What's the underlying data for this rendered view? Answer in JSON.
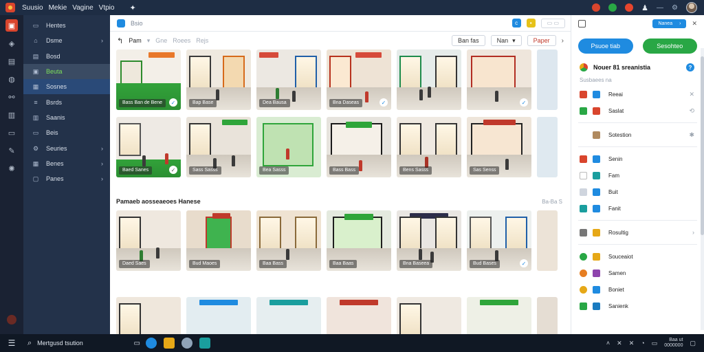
{
  "app": {
    "menu": [
      "Suusio",
      "Mekie",
      "Vagine",
      "Vtpio"
    ],
    "title": "Bsio"
  },
  "sidebar": {
    "items": [
      {
        "label": "Hentes",
        "icon": "folder-icon",
        "chevron": false
      },
      {
        "label": "Dsme",
        "icon": "home-icon",
        "chevron": true
      },
      {
        "label": "Bosd",
        "icon": "doc-icon",
        "chevron": false
      },
      {
        "label": "Beuta",
        "icon": "image-icon",
        "chevron": false,
        "selected": "green"
      },
      {
        "label": "Sosnes",
        "icon": "list-icon",
        "chevron": false,
        "selected": "blue"
      },
      {
        "label": "Bsrds",
        "icon": "stack-icon",
        "chevron": false
      },
      {
        "label": "Saanis",
        "icon": "grid-icon",
        "chevron": false
      },
      {
        "label": "Beis",
        "icon": "tag-icon",
        "chevron": false
      },
      {
        "label": "Seuries",
        "icon": "settings-icon",
        "chevron": true
      },
      {
        "label": "Benes",
        "icon": "calendar-icon",
        "chevron": true
      },
      {
        "label": "Panes",
        "icon": "star-icon",
        "chevron": true
      }
    ]
  },
  "filterbar": {
    "primary": "Pam",
    "secondary": [
      "Gne",
      "Roees",
      "Rejs"
    ],
    "button1": "Ban fas",
    "select": "Nan",
    "button2": "Paper"
  },
  "tiles_row1": [
    "Bass Ban de Bene",
    "Bap Base",
    "Dea Bausa",
    "Bna Daseas",
    "",
    ""
  ],
  "tiles_row2": [
    "Baed Sanes",
    "Sass Sasss",
    "Bea Sasss",
    "Bass Bass",
    "Bens Sasss",
    "Sas Senss"
  ],
  "section": {
    "title": "Pamaeb aosseaeoes Hanese",
    "more": "Ba-Ba S"
  },
  "tiles_row3": [
    "Daed Saes",
    "Bud Maoes",
    "Baa Bass",
    "Baa Baas",
    "Bna Baseea",
    "Bud Bases"
  ],
  "rpanel": {
    "pill": "Nanea",
    "btn_blue": "Psuoe tiab",
    "btn_green": "Sesohteo",
    "header": "Nouer 81 sreanistia",
    "subheader": "Susbaees na",
    "items": [
      {
        "label": "Reeai",
        "c1": "#d9452d",
        "c2": "#1f8be0",
        "act": "✕"
      },
      {
        "label": "Saslat",
        "c1": "#29a745",
        "c2": "#d9452d",
        "act": "⟲"
      },
      {
        "label": "Sotestion",
        "c1": "#ffffff",
        "c2": "#b08a60",
        "act": "✱",
        "gap": true
      },
      {
        "label": "Senin",
        "c1": "#d9452d",
        "c2": "#1f8be0",
        "act": ""
      },
      {
        "label": "Fam",
        "c1": "#ffffff",
        "c2": "#1a9e9e",
        "act": ""
      },
      {
        "label": "Buit",
        "c1": "#cfd5de",
        "c2": "#1f8be0",
        "act": ""
      },
      {
        "label": "Fanit",
        "c1": "#1a9e9e",
        "c2": "#1f8be0",
        "act": ""
      },
      {
        "label": "Rosultig",
        "c1": "#777777",
        "c2": "#e6a817",
        "act": "›",
        "sep": true
      },
      {
        "label": "Souceaiot",
        "c1": "#29a745",
        "c2": "#e6a817",
        "act": "",
        "sep": true
      },
      {
        "label": "Samen",
        "c1": "#e67e22",
        "c2": "#8e44ad",
        "act": ""
      },
      {
        "label": "Boniet",
        "c1": "#e6a817",
        "c2": "#1f8be0",
        "act": ""
      },
      {
        "label": "Sanienk",
        "c1": "#29a745",
        "c2": "#1a7bc0",
        "act": ""
      }
    ]
  },
  "taskbar": {
    "search": "Mertgusd tsution",
    "time": "Baa ut",
    "date": "0000000"
  }
}
